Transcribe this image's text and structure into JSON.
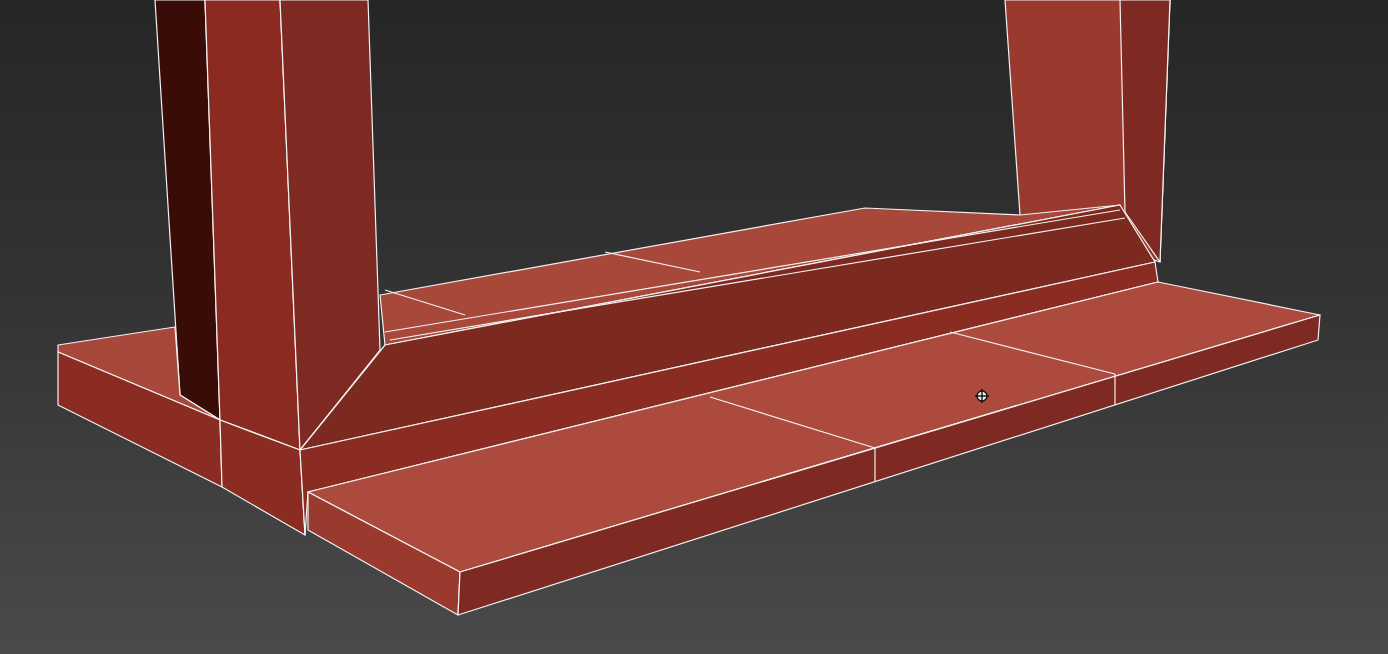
{
  "viewport": {
    "edged_faces": true
  }
}
